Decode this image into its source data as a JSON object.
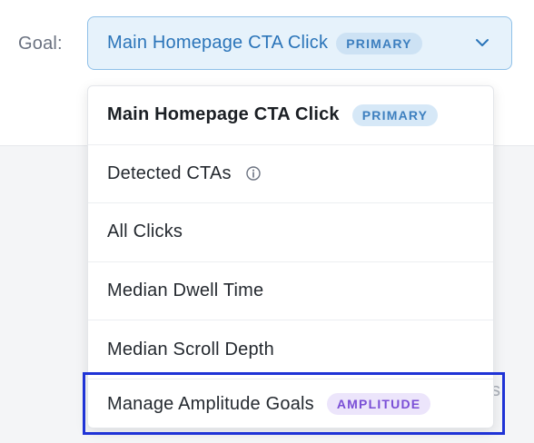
{
  "goal_selector": {
    "label": "Goal:",
    "selected_value": "Main Homepage CTA Click",
    "selected_badge": "PRIMARY",
    "chevron_icon": "chevron-down-icon"
  },
  "dropdown": {
    "items": [
      {
        "label": "Main Homepage CTA Click",
        "badge": "PRIMARY",
        "selected": true
      },
      {
        "label": "Detected CTAs",
        "icon": "info-icon"
      },
      {
        "label": "All Clicks"
      },
      {
        "label": "Median Dwell Time"
      },
      {
        "label": "Median Scroll Depth"
      },
      {
        "label": "Manage Amplitude Goals",
        "badge": "AMPLITUDE",
        "highlighted": true
      }
    ]
  },
  "background": {
    "partial_text": "s"
  },
  "colors": {
    "select_bg": "#e6f2fb",
    "select_border": "#8fc0e8",
    "select_text": "#2a74b9",
    "primary_badge_bg": "#d6e8f7",
    "primary_badge_text": "#3d7fbf",
    "amplitude_badge_bg": "#ece5fb",
    "amplitude_badge_text": "#7a4fd6",
    "highlight_border": "#1f33d6"
  }
}
